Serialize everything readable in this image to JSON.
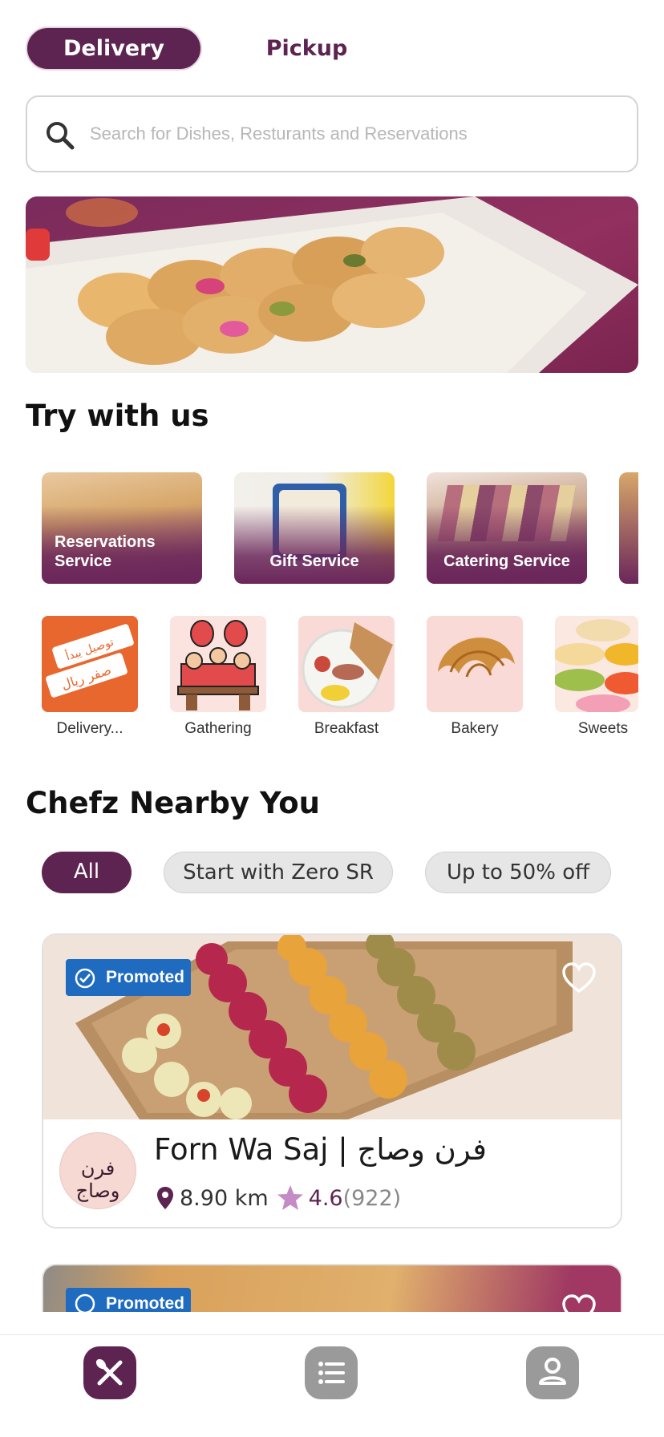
{
  "header": {
    "mode_active": "Delivery",
    "mode_other": "Pickup"
  },
  "search": {
    "placeholder": "Search for Dishes, Resturants and Reservations",
    "value": ""
  },
  "try_section": {
    "title": "Try with us",
    "services": [
      {
        "label": "Reservations Service"
      },
      {
        "label": "Gift Service"
      },
      {
        "label": "Catering Service"
      }
    ],
    "categories": [
      {
        "label": "Delivery..."
      },
      {
        "label": "Gathering"
      },
      {
        "label": "Breakfast"
      },
      {
        "label": "Bakery"
      },
      {
        "label": "Sweets"
      }
    ],
    "delivery_tile_text": "توصيل يبدأ من صفر ريال"
  },
  "chefz_section": {
    "title": "Chefz Nearby You",
    "filters": [
      {
        "label": "All",
        "active": true
      },
      {
        "label": "Start with Zero SR",
        "active": false
      },
      {
        "label": "Up to 50% off",
        "active": false
      }
    ]
  },
  "restaurants": [
    {
      "name": "Forn Wa Saj | فرن وصاج",
      "badge": "Promoted",
      "distance": "8.90 km",
      "rating": "4.6",
      "reviews": "(922)",
      "logo_text": "فرن وصاج"
    },
    {
      "badge": "Promoted"
    }
  ],
  "bottom_nav": [
    {
      "icon": "utensils-icon",
      "active": true
    },
    {
      "icon": "list-icon",
      "active": false
    },
    {
      "icon": "profile-icon",
      "active": false
    }
  ],
  "colors": {
    "brand": "#5e2451",
    "promo_blue": "#1e6bbf",
    "star": "#c58bc6"
  }
}
